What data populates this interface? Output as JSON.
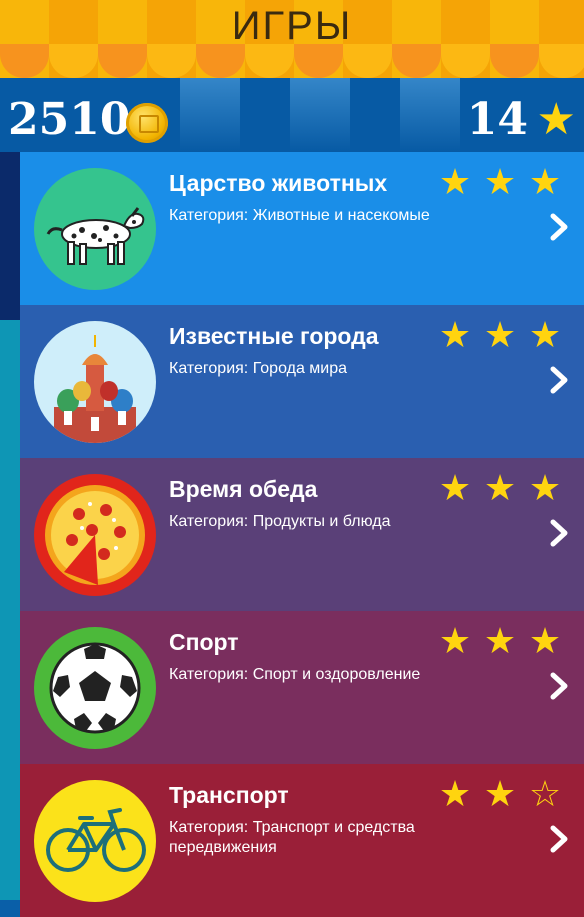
{
  "header": {
    "title": "ИГРЫ"
  },
  "stats": {
    "coins": "2510",
    "coin_icon": "coin-icon",
    "stars": "14",
    "star_icon": "star-icon"
  },
  "colors": {
    "accent": "#ffd40f",
    "awning": "#f8b60a",
    "background": "#0a5fa8"
  },
  "games": [
    {
      "title": "Царство животных",
      "category": "Категория: Животные и насекомые",
      "stars": 3,
      "max_stars": 3,
      "card_color": "#1a8ee8",
      "icon": "dalmatian-icon"
    },
    {
      "title": "Известные города",
      "category": "Категория: Города мира",
      "stars": 3,
      "max_stars": 3,
      "card_color": "#2a5fb0",
      "icon": "kremlin-cathedral-icon"
    },
    {
      "title": "Время обеда",
      "category": "Категория: Продукты и блюда",
      "stars": 3,
      "max_stars": 3,
      "card_color": "#5a4078",
      "icon": "pizza-icon"
    },
    {
      "title": "Спорт",
      "category": "Категория: Спорт и оздоровление",
      "stars": 3,
      "max_stars": 3,
      "card_color": "#7a2e5e",
      "icon": "soccer-ball-icon"
    },
    {
      "title": "Транспорт",
      "category": "Категория: Транспорт и средства передвижения",
      "stars": 2,
      "max_stars": 3,
      "card_color": "#9a1f38",
      "icon": "bicycle-icon"
    }
  ]
}
